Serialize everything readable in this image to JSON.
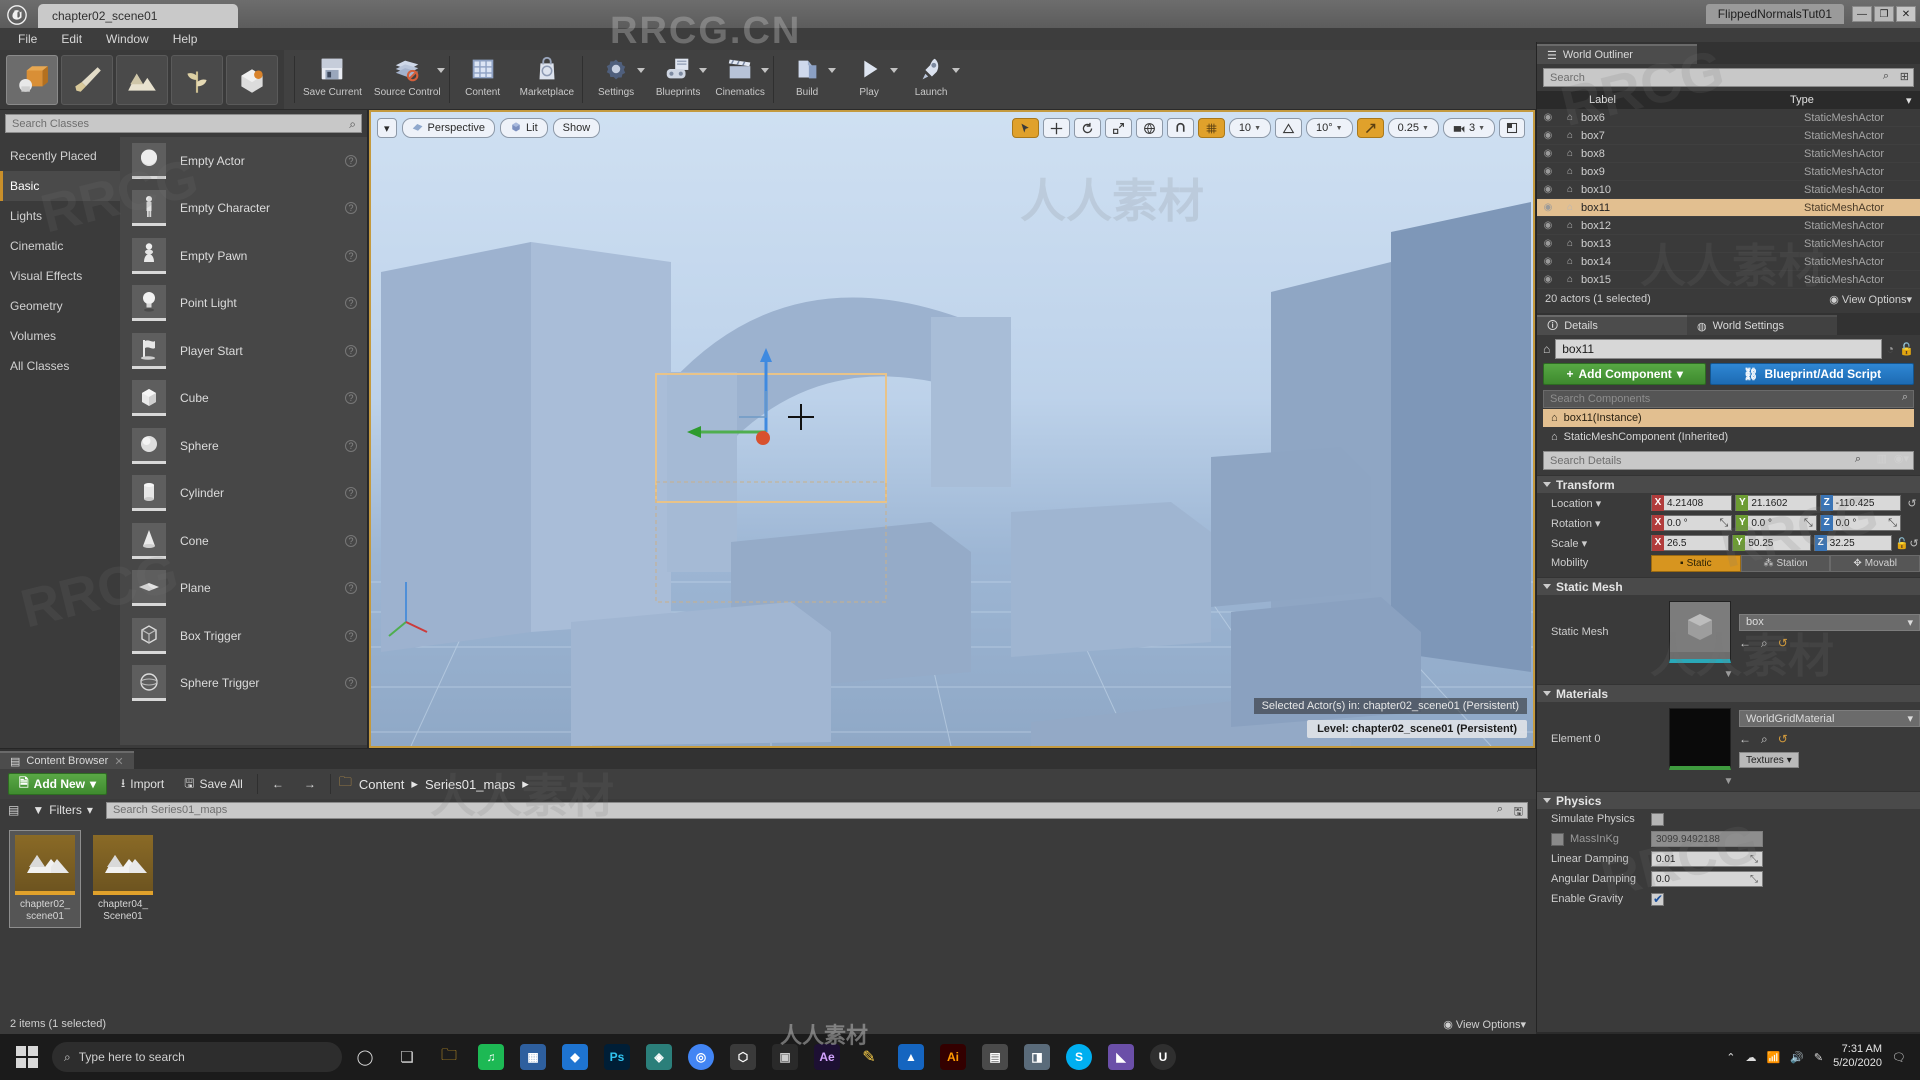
{
  "titlebar": {
    "project_tab": "chapter02_scene01",
    "tutorial_tab": "FlippedNormalsTut01",
    "minimize": "—",
    "maximize": "❐",
    "close": "✕",
    "logo_icon": "unreal-logo"
  },
  "menubar": {
    "items": [
      "File",
      "Edit",
      "Window",
      "Help"
    ]
  },
  "modes": [
    {
      "name": "place-mode",
      "icon": "place-actors-icon"
    },
    {
      "name": "paint-mode",
      "icon": "paint-brush-icon"
    },
    {
      "name": "landscape-mode",
      "icon": "landscape-icon"
    },
    {
      "name": "foliage-mode",
      "icon": "foliage-leaf-icon"
    },
    {
      "name": "geometry-mode",
      "icon": "geometry-editing-icon"
    }
  ],
  "toolbar": [
    {
      "label": "Save Current",
      "icon": "floppy-disk-icon",
      "caret": false
    },
    {
      "label": "Source Control",
      "icon": "source-control-icon",
      "caret": true
    },
    {
      "label": "Content",
      "icon": "content-grid-icon",
      "caret": false
    },
    {
      "label": "Marketplace",
      "icon": "marketplace-bag-icon",
      "caret": false
    },
    {
      "label": "Settings",
      "icon": "gear-icon",
      "caret": true
    },
    {
      "label": "Blueprints",
      "icon": "blueprint-icon",
      "caret": true
    },
    {
      "label": "Cinematics",
      "icon": "clapperboard-icon",
      "caret": true
    },
    {
      "label": "Build",
      "icon": "build-icon",
      "caret": true
    },
    {
      "label": "Play",
      "icon": "play-icon",
      "caret": true
    },
    {
      "label": "Launch",
      "icon": "launch-rocket-icon",
      "caret": true
    }
  ],
  "place_actors": {
    "search_placeholder": "Search Classes",
    "categories": [
      "Recently Placed",
      "Basic",
      "Lights",
      "Cinematic",
      "Visual Effects",
      "Geometry",
      "Volumes",
      "All Classes"
    ],
    "active_category": "Basic",
    "actors": [
      {
        "label": "Empty Actor",
        "icon": "empty-actor-icon"
      },
      {
        "label": "Empty Character",
        "icon": "character-icon"
      },
      {
        "label": "Empty Pawn",
        "icon": "pawn-icon"
      },
      {
        "label": "Point Light",
        "icon": "point-light-icon"
      },
      {
        "label": "Player Start",
        "icon": "player-start-icon"
      },
      {
        "label": "Cube",
        "icon": "cube-icon"
      },
      {
        "label": "Sphere",
        "icon": "sphere-icon"
      },
      {
        "label": "Cylinder",
        "icon": "cylinder-icon"
      },
      {
        "label": "Cone",
        "icon": "cone-icon"
      },
      {
        "label": "Plane",
        "icon": "plane-icon"
      },
      {
        "label": "Box Trigger",
        "icon": "box-trigger-icon"
      },
      {
        "label": "Sphere Trigger",
        "icon": "sphere-trigger-icon"
      }
    ]
  },
  "viewport": {
    "menu_caret": "▾",
    "perspective": "Perspective",
    "lit": "Lit",
    "show": "Show",
    "grid_snap_value": "10",
    "rotation_snap_value": "10°",
    "scale_snap_value": "0.25",
    "camera_speed_value": "3",
    "status_text": "Selected Actor(s) in: chapter02_scene01 (Persistent)",
    "level_text": "Level: chapter02_scene01 (Persistent)",
    "accent_active": "#e0a12b"
  },
  "outliner": {
    "tab_label": "World Outliner",
    "search_placeholder": "Search",
    "col_label": "Label",
    "col_type": "Type",
    "rows": [
      {
        "label": "box6",
        "type": "StaticMeshActor",
        "selected": false
      },
      {
        "label": "box7",
        "type": "StaticMeshActor",
        "selected": false
      },
      {
        "label": "box8",
        "type": "StaticMeshActor",
        "selected": false
      },
      {
        "label": "box9",
        "type": "StaticMeshActor",
        "selected": false
      },
      {
        "label": "box10",
        "type": "StaticMeshActor",
        "selected": false
      },
      {
        "label": "box11",
        "type": "StaticMeshActor",
        "selected": true
      },
      {
        "label": "box12",
        "type": "StaticMeshActor",
        "selected": false
      },
      {
        "label": "box13",
        "type": "StaticMeshActor",
        "selected": false
      },
      {
        "label": "box14",
        "type": "StaticMeshActor",
        "selected": false
      },
      {
        "label": "box15",
        "type": "StaticMeshActor",
        "selected": false
      }
    ],
    "footer_count": "20 actors (1 selected)",
    "view_options": "View Options"
  },
  "details": {
    "tab_details": "Details",
    "tab_world_settings": "World Settings",
    "actor_name": "box11",
    "add_component": "Add Component",
    "blueprint_button": "Blueprint/Add Script",
    "search_components_placeholder": "Search Components",
    "components": [
      {
        "label": "box11(Instance)",
        "selected": true
      },
      {
        "label": "StaticMeshComponent (Inherited)",
        "selected": false
      }
    ],
    "search_details_placeholder": "Search Details",
    "transform": {
      "title": "Transform",
      "location_label": "Location",
      "location": {
        "x": "4.21408",
        "y": "21.1602",
        "z": "-110.425"
      },
      "rotation_label": "Rotation",
      "rotation": {
        "x": "0.0 °",
        "y": "0.0 °",
        "z": "0.0 °"
      },
      "scale_label": "Scale",
      "scale": {
        "x": "26.5",
        "y": "50.25",
        "z": "32.25"
      },
      "mobility_label": "Mobility",
      "mobility_options": [
        "Static",
        "Station",
        "Movabl"
      ],
      "mobility_selected": "Static"
    },
    "static_mesh": {
      "title": "Static Mesh",
      "row_label": "Static Mesh",
      "asset_name": "box"
    },
    "materials": {
      "title": "Materials",
      "row_label": "Element 0",
      "material_name": "WorldGridMaterial",
      "textures_button": "Textures"
    },
    "physics": {
      "title": "Physics",
      "simulate_physics_label": "Simulate Physics",
      "simulate_physics_checked": false,
      "mass_label": "MassInKg",
      "mass_value": "3099.9492188",
      "mass_checked": false,
      "linear_damping_label": "Linear Damping",
      "linear_damping_value": "0.01",
      "angular_damping_label": "Angular Damping",
      "angular_damping_value": "0.0",
      "enable_gravity_label": "Enable Gravity",
      "enable_gravity_checked": true
    }
  },
  "content_browser": {
    "tab_label": "Content Browser",
    "add_new": "Add New",
    "import": "Import",
    "save_all": "Save All",
    "back_arrow": "←",
    "forward_arrow": "→",
    "breadcrumb": [
      "Content",
      "Series01_maps"
    ],
    "filters": "Filters",
    "search_placeholder": "Search Series01_maps",
    "assets": [
      {
        "label": "chapter02_\nscene01",
        "selected": true
      },
      {
        "label": "chapter04_\nScene01",
        "selected": false
      }
    ],
    "footer_count": "2 items (1 selected)",
    "view_options": "View Options"
  },
  "taskbar": {
    "search_placeholder": "Type here to search",
    "apps": [
      {
        "name": "cortana-icon",
        "glyph": "◯",
        "color": "#d8d8d8",
        "bg": "transparent"
      },
      {
        "name": "task-view-icon",
        "glyph": "❏",
        "color": "#d8d8d8",
        "bg": "transparent"
      },
      {
        "name": "file-explorer-icon",
        "glyph": "🗀",
        "color": "#f0b429",
        "bg": "transparent"
      },
      {
        "name": "spotify-icon",
        "glyph": "♫",
        "color": "#ffffff",
        "bg": "#1db954"
      },
      {
        "name": "app-blue-icon",
        "glyph": "▦",
        "color": "#ffffff",
        "bg": "#2e5f9e"
      },
      {
        "name": "dropbox-icon",
        "glyph": "◆",
        "color": "#ffffff",
        "bg": "#1e74d1"
      },
      {
        "name": "photoshop-icon",
        "glyph": "Ps",
        "color": "#31c5f0",
        "bg": "#001e36"
      },
      {
        "name": "app-teal-icon",
        "glyph": "◈",
        "color": "#ffffff",
        "bg": "#2b7f7a"
      },
      {
        "name": "chrome-icon",
        "glyph": "◎",
        "color": "#ffffff",
        "bg": "#4285f4"
      },
      {
        "name": "unity-icon",
        "glyph": "⬡",
        "color": "#ffffff",
        "bg": "#3a3a3a"
      },
      {
        "name": "app-dark-icon",
        "glyph": "▣",
        "color": "#cccccc",
        "bg": "#2a2a2a"
      },
      {
        "name": "after-effects-icon",
        "glyph": "Ae",
        "color": "#d3a3ff",
        "bg": "#1d1033"
      },
      {
        "name": "app-yellow-icon",
        "glyph": "✎",
        "color": "#ffd24a",
        "bg": "transparent"
      },
      {
        "name": "blue-app-icon",
        "glyph": "▲",
        "color": "#ffffff",
        "bg": "#1565c0"
      },
      {
        "name": "illustrator-icon",
        "glyph": "Ai",
        "color": "#ff9a00",
        "bg": "#330000"
      },
      {
        "name": "app-gray-icon",
        "glyph": "▤",
        "color": "#dddddd",
        "bg": "#4a4a4a"
      },
      {
        "name": "app-pic-icon",
        "glyph": "◨",
        "color": "#e0e0e0",
        "bg": "#5a6b7a"
      },
      {
        "name": "skype-icon",
        "glyph": "S",
        "color": "#ffffff",
        "bg": "#00aff0"
      },
      {
        "name": "app-purple-icon",
        "glyph": "◣",
        "color": "#ffffff",
        "bg": "#6b4fa8"
      },
      {
        "name": "unreal-taskbar-icon",
        "glyph": "U",
        "color": "#ffffff",
        "bg": "#2f2f2f"
      }
    ],
    "tray": {
      "chevron": "⌃",
      "network_icon": "network-icon",
      "volume_icon": "volume-icon",
      "onedrive_icon": "onedrive-icon",
      "time": "7:31 AM",
      "date": "5/20/2020",
      "notification_icon": "notification-icon"
    }
  },
  "watermarks": {
    "main": "RRCG.CN",
    "chinese": "人人素材",
    "rrcg": "RRCG"
  }
}
